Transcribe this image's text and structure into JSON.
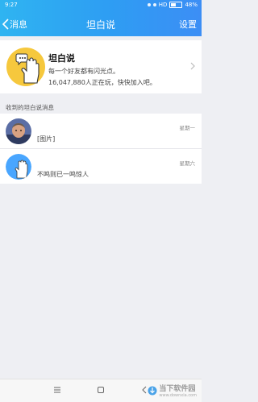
{
  "status_bar": {
    "time": "9:27",
    "carrier": "HD",
    "battery": "48%"
  },
  "nav": {
    "back_label": "消息",
    "title": "坦白说",
    "settings_label": "设置"
  },
  "feature": {
    "name": "坦白说",
    "desc_line1": "每一个好友都有闪光点。",
    "desc_line2": "16,047,880人正在玩，快快加入吧。"
  },
  "section_label": "收到的坦白说消息",
  "messages": [
    {
      "day": "星期一",
      "preview": "[图片]"
    },
    {
      "day": "星期六",
      "preview": "不鸣则已一鸣惊人"
    }
  ],
  "watermark": {
    "text": "当下软件园",
    "url": "www.downxia.com"
  },
  "colors": {
    "header_start": "#2fb4f1",
    "header_end": "#3c8ef5",
    "accent_yellow": "#f6c83d",
    "hand_blue": "#49a6ff"
  }
}
